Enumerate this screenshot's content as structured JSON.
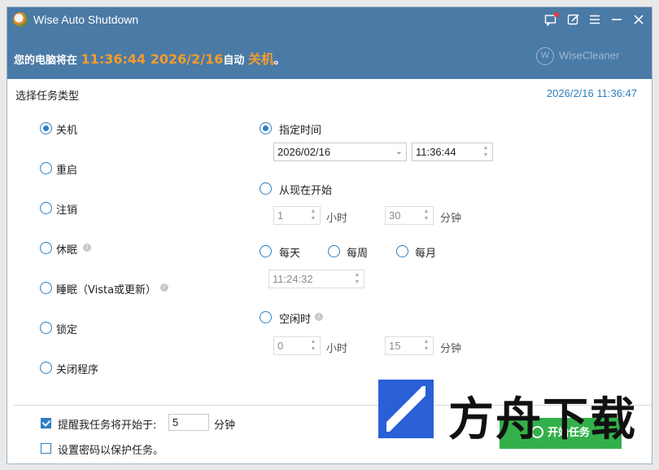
{
  "titlebar": {
    "app_title": "Wise Auto Shutdown",
    "icons": [
      "message-icon",
      "edit-icon",
      "menu-icon",
      "minimize-icon",
      "close-icon"
    ]
  },
  "status": {
    "prefix": "您的电脑将在",
    "time": "11:36:44 2026/2/16",
    "middle": "自动",
    "action": "关机",
    "suffix": "。"
  },
  "brand": {
    "logo_letter": "W",
    "name": "WiseCleaner"
  },
  "section": {
    "label": "选择任务类型",
    "current_datetime": "2026/2/16 11:36:47"
  },
  "task_types": [
    {
      "label": "关机",
      "checked": true
    },
    {
      "label": "重启",
      "checked": false
    },
    {
      "label": "注销",
      "checked": false
    },
    {
      "label": "休眠",
      "checked": false,
      "info": true
    },
    {
      "label": "睡眠（Vista或更新）",
      "checked": false,
      "info": true
    },
    {
      "label": "锁定",
      "checked": false
    },
    {
      "label": "关闭程序",
      "checked": false
    }
  ],
  "schedule": {
    "specified": {
      "label": "指定时间",
      "checked": true,
      "date": "2026/02/16",
      "time": "11:36:44"
    },
    "from_now": {
      "label": "从现在开始",
      "checked": false,
      "hours": "1",
      "hours_unit": "小时",
      "minutes": "30",
      "minutes_unit": "分钟"
    },
    "daily": {
      "label": "每天",
      "checked": false
    },
    "weekly": {
      "label": "每周",
      "checked": false
    },
    "monthly": {
      "label": "每月",
      "checked": false
    },
    "repeat_time": "11:24:32",
    "idle": {
      "label": "空闲时",
      "checked": false,
      "hours": "0",
      "hours_unit": "小时",
      "minutes": "15",
      "minutes_unit": "分钟"
    }
  },
  "footer": {
    "remind": {
      "label": "提醒我任务将开始于:",
      "checked": true,
      "value": "5",
      "unit": "分钟"
    },
    "password": {
      "label": "设置密码以保护任务。",
      "checked": false
    },
    "start_button": "开始任务"
  },
  "watermark": {
    "text": "方舟下载"
  },
  "colors": {
    "titlebar": "#4a7aa6",
    "accent": "#2f7fc1",
    "highlight": "#f39c2b",
    "start_button": "#33b04a"
  }
}
